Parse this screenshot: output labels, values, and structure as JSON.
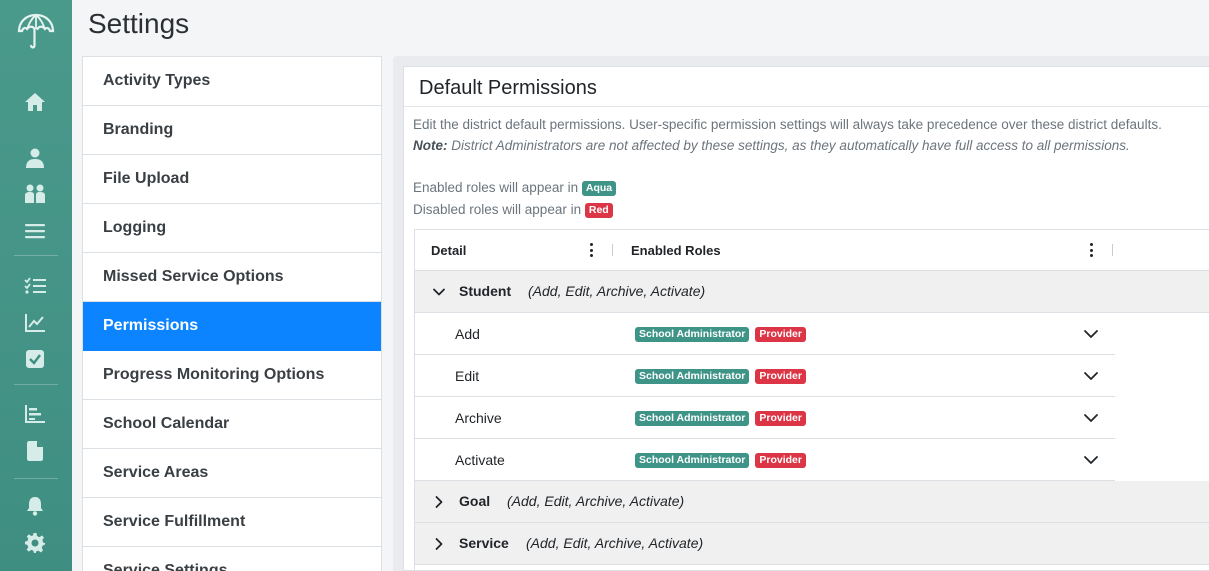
{
  "page": {
    "title": "Settings"
  },
  "rail": {
    "icons": [
      "umbrella-logo-icon",
      "home-icon",
      "user-icon",
      "users-icon",
      "list-icon",
      "checklist-icon",
      "line-chart-icon",
      "check-square-icon",
      "bar-chart-icon",
      "file-icon",
      "bell-icon",
      "gear-icon"
    ]
  },
  "menu": {
    "items": [
      {
        "label": "Activity Types"
      },
      {
        "label": "Branding"
      },
      {
        "label": "File Upload"
      },
      {
        "label": "Logging"
      },
      {
        "label": "Missed Service Options"
      },
      {
        "label": "Permissions",
        "active": true
      },
      {
        "label": "Progress Monitoring Options"
      },
      {
        "label": "School Calendar"
      },
      {
        "label": "Service Areas"
      },
      {
        "label": "Service Fulfillment"
      },
      {
        "label": "Service Settings"
      }
    ]
  },
  "panel": {
    "title": "Default Permissions",
    "description": "Edit the district default permissions. User-specific permission settings will always take precedence over these district defaults.",
    "note_label": "Note:",
    "note_text": "District Administrators are not affected by these settings, as they automatically have full access to all permissions.",
    "enabled_text": "Enabled roles will appear in",
    "enabled_tag": "Aqua",
    "disabled_text": "Disabled roles will appear in",
    "disabled_tag": "Red"
  },
  "grid": {
    "columns": [
      "Detail",
      "Enabled Roles"
    ],
    "groups": [
      {
        "name": "Student",
        "actions": "(Add, Edit, Archive, Activate)",
        "expanded": true,
        "rows": [
          {
            "name": "Add",
            "roles": [
              {
                "label": "School Administrator",
                "color": "aqua"
              },
              {
                "label": "Provider",
                "color": "red"
              }
            ]
          },
          {
            "name": "Edit",
            "roles": [
              {
                "label": "School Administrator",
                "color": "aqua"
              },
              {
                "label": "Provider",
                "color": "red"
              }
            ]
          },
          {
            "name": "Archive",
            "roles": [
              {
                "label": "School Administrator",
                "color": "aqua"
              },
              {
                "label": "Provider",
                "color": "red"
              }
            ]
          },
          {
            "name": "Activate",
            "roles": [
              {
                "label": "School Administrator",
                "color": "aqua"
              },
              {
                "label": "Provider",
                "color": "red"
              }
            ]
          }
        ]
      },
      {
        "name": "Goal",
        "actions": "(Add, Edit, Archive, Activate)",
        "expanded": false,
        "rows": []
      },
      {
        "name": "Service",
        "actions": "(Add, Edit, Archive, Activate)",
        "expanded": false,
        "rows": []
      }
    ]
  },
  "colors": {
    "rail": "#4a9a8c",
    "active": "#0d84ff",
    "aqua": "#3f9488",
    "red": "#dc3545"
  }
}
